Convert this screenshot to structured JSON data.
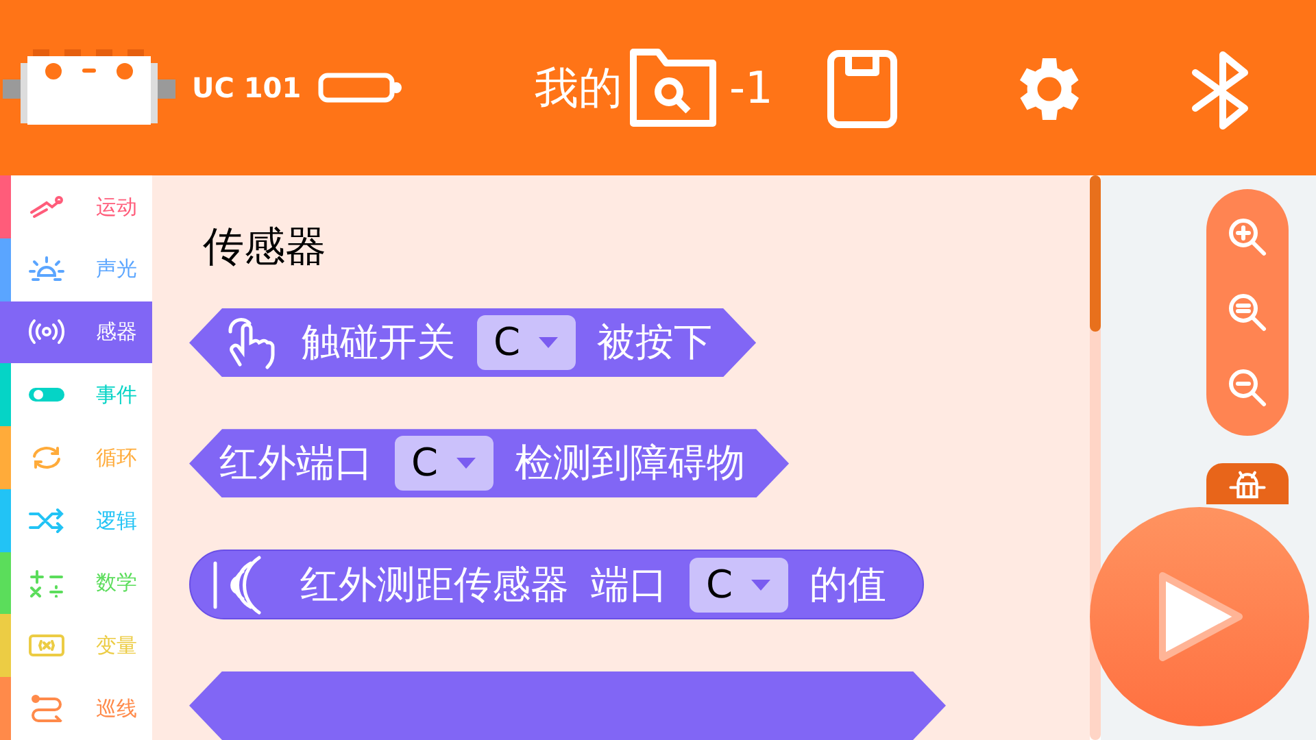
{
  "header": {
    "device_name": "UC 101",
    "title_parts": [
      "我的",
      "-1"
    ]
  },
  "sidebar": {
    "items": [
      {
        "label": "运动",
        "color": "#ff5c7a",
        "selected": false
      },
      {
        "label": "声光",
        "color": "#5aa5ff",
        "selected": false
      },
      {
        "label": "感器",
        "color": "#8166f5",
        "selected": true
      },
      {
        "label": "事件",
        "color": "#05d4c6",
        "selected": false
      },
      {
        "label": "循环",
        "color": "#ffab3a",
        "selected": false
      },
      {
        "label": "逻辑",
        "color": "#22c3f5",
        "selected": false
      },
      {
        "label": "数学",
        "color": "#5bdd5b",
        "selected": false
      },
      {
        "label": "变量",
        "color": "#eccc44",
        "selected": false
      },
      {
        "label": "巡线",
        "color": "#ff8a4a",
        "selected": false
      }
    ]
  },
  "category_title": "传感器",
  "blocks": [
    {
      "kind": "hexagon",
      "parts": [
        {
          "kind": "icon"
        },
        {
          "kind": "text",
          "text": "触碰开关"
        },
        {
          "kind": "dropdown",
          "value": "C"
        },
        {
          "kind": "text",
          "text": "被按下"
        }
      ]
    },
    {
      "kind": "hexagon",
      "parts": [
        {
          "kind": "text",
          "text": "红外端口"
        },
        {
          "kind": "dropdown",
          "value": "C"
        },
        {
          "kind": "text",
          "text": "检测到障碍物"
        }
      ]
    },
    {
      "kind": "round",
      "parts": [
        {
          "kind": "icon"
        },
        {
          "kind": "text",
          "text": "红外测距传感器"
        },
        {
          "kind": "text",
          "text": "端口"
        },
        {
          "kind": "dropdown",
          "value": "C"
        },
        {
          "kind": "text",
          "text": "的值"
        }
      ]
    }
  ]
}
